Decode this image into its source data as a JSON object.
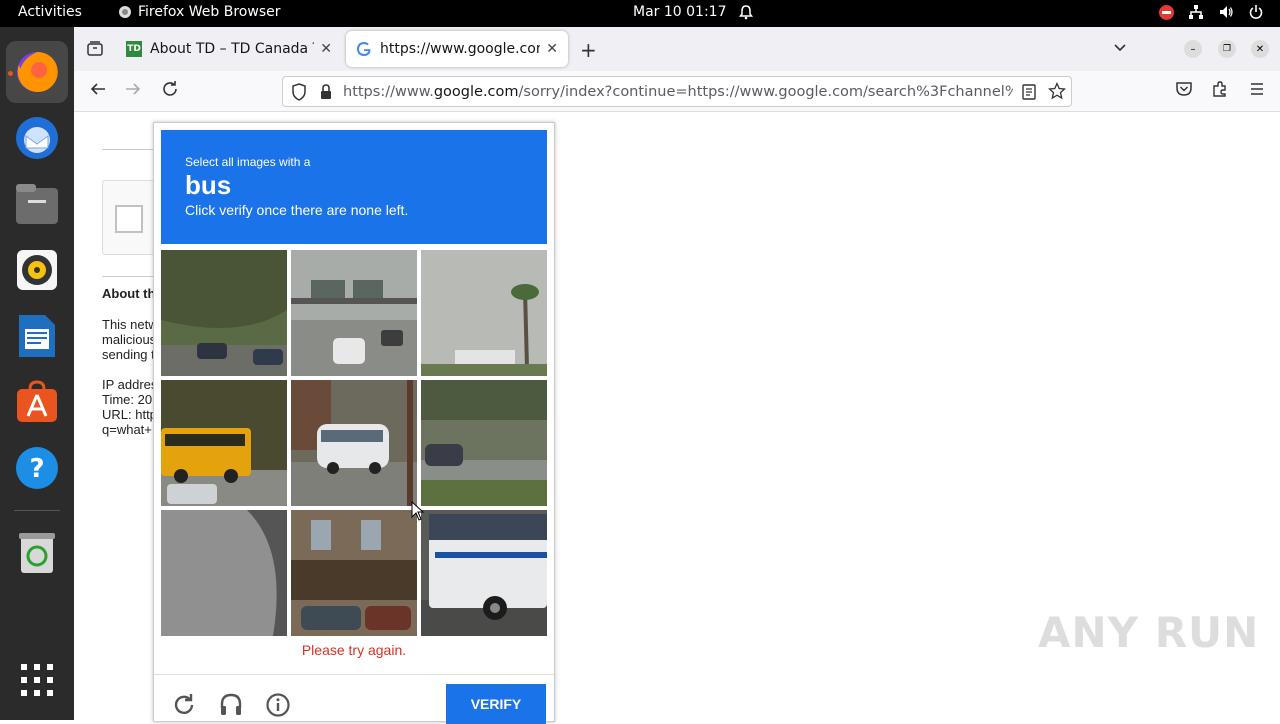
{
  "topbar": {
    "activities": "Activities",
    "app_name": "Firefox Web Browser",
    "clock": "Mar 10  01:17"
  },
  "dock": {
    "items": [
      "firefox",
      "thunderbird",
      "files",
      "rhythmbox",
      "libreoffice-writer",
      "app-center",
      "help",
      "trash",
      "show-apps"
    ]
  },
  "browser": {
    "tabs": [
      {
        "title": "About TD – TD Canada Tr",
        "active": false
      },
      {
        "title": "https://www.google.com/",
        "active": true
      }
    ],
    "url_prefix": "https://www.",
    "url_domain": "google.com",
    "url_rest": "/sorry/index?continue=https://www.google.com/search%3Fchannel%3"
  },
  "background_page": {
    "about_heading": "About th",
    "para_lines": [
      "This netw",
      "malicious",
      "sending t"
    ],
    "ip_line": "IP addres",
    "time_line": "Time: 20",
    "url_line": "URL: http",
    "q_line": "q=what+"
  },
  "captcha": {
    "instruction_top": "Select all images with a",
    "target": "bus",
    "instruction_bottom": "Click verify once there are none left.",
    "error": "Please try again.",
    "verify_label": "VERIFY",
    "tiles": [
      "hillside-cars",
      "highway-signs",
      "palm-tree-sky",
      "school-bus",
      "white-shuttle-bus",
      "car-on-road",
      "gray-wall",
      "brick-building",
      "city-bus"
    ],
    "accent": "#1a73e8",
    "error_color": "#d93025"
  },
  "watermark": "ANY RUN"
}
